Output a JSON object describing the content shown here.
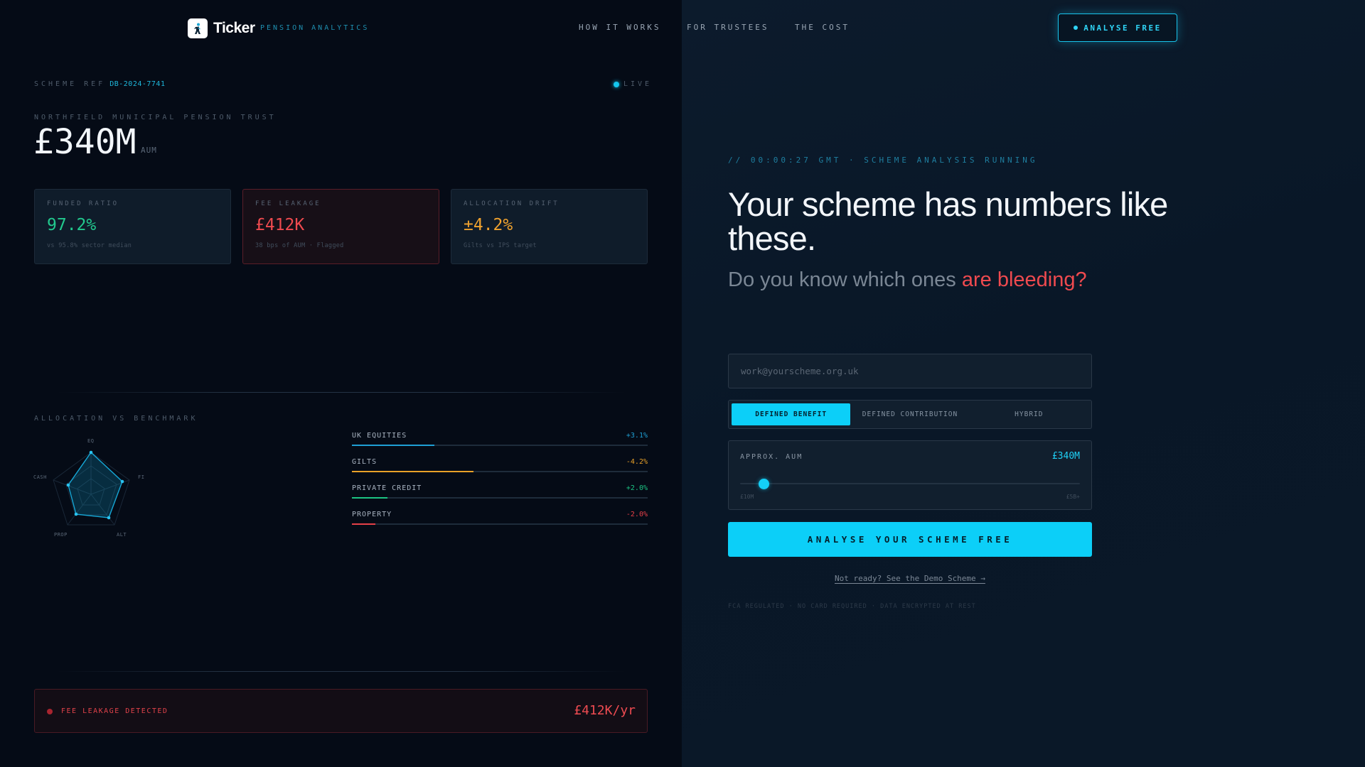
{
  "nav": {
    "brand": "Ticker",
    "tagline": "PENSION ANALYTICS",
    "links": [
      "HOW IT WORKS",
      "FOR TRUSTEES",
      "THE COST"
    ],
    "cta": "ANALYSE FREE"
  },
  "scheme": {
    "ref_label": "SCHEME REF",
    "ref_value": "DB-2024-7741",
    "live_label": "LIVE",
    "trust_name": "NORTHFIELD MUNICIPAL PENSION TRUST",
    "aum_value": "£340M",
    "aum_unit": "AUM"
  },
  "metrics": [
    {
      "label": "FUNDED RATIO",
      "value": "97.2%",
      "note": "vs 95.8% sector median",
      "color": "#22c98e"
    },
    {
      "label": "FEE LEAKAGE",
      "value": "£412K",
      "note": "38 bps of AUM · Flagged",
      "color": "#ef4a4f"
    },
    {
      "label": "ALLOCATION DRIFT",
      "value": "±4.2%",
      "note": "Gilts vs IPS target",
      "color": "#f0a22e"
    }
  ],
  "allocation": {
    "title": "ALLOCATION VS BENCHMARK",
    "radar_labels": [
      "EQ",
      "FI",
      "ALT",
      "PROP",
      "CASH"
    ],
    "bars": [
      {
        "name": "UK EQUITIES",
        "value": "+3.1%",
        "fill": 0.28,
        "color": "#1f9fd4"
      },
      {
        "name": "GILTS",
        "value": "-4.2%",
        "fill": 0.41,
        "color": "#e9a128"
      },
      {
        "name": "PRIVATE CREDIT",
        "value": "+2.0%",
        "fill": 0.12,
        "color": "#1cc383"
      },
      {
        "name": "PROPERTY",
        "value": "-2.0%",
        "fill": 0.08,
        "color": "#e64048"
      }
    ]
  },
  "alert": {
    "label": "FEE LEAKAGE DETECTED",
    "value": "£412K/yr"
  },
  "hero": {
    "status": "// 00:00:27 GMT · SCHEME ANALYSIS RUNNING",
    "headline": "Your scheme has numbers like these.",
    "subhead_plain": "Do you know which ones ",
    "subhead_highlight": "are bleeding?"
  },
  "form": {
    "email_placeholder": "work@yourscheme.org.uk",
    "scheme_types": [
      "DEFINED BENEFIT",
      "DEFINED CONTRIBUTION",
      "HYBRID"
    ],
    "selected_type": "DEFINED BENEFIT",
    "aum_label": "APPROX. AUM",
    "aum_value": "£340M",
    "aum_min": "£10M",
    "aum_max": "£5B+",
    "aum_slider_position": 0.07,
    "submit": "ANALYSE YOUR SCHEME FREE",
    "demo_link": "Not ready? See the Demo Scheme →",
    "legal": "FCA REGULATED · NO CARD REQUIRED · DATA ENCRYPTED AT REST"
  },
  "colors": {
    "accent": "#0ccff8",
    "danger": "#ef4a4f",
    "success": "#22c98e",
    "warning": "#f0a22e"
  },
  "icons": {
    "logo": "figure-icon",
    "live": "pulse-dot-icon",
    "alert": "alert-dot-icon"
  }
}
